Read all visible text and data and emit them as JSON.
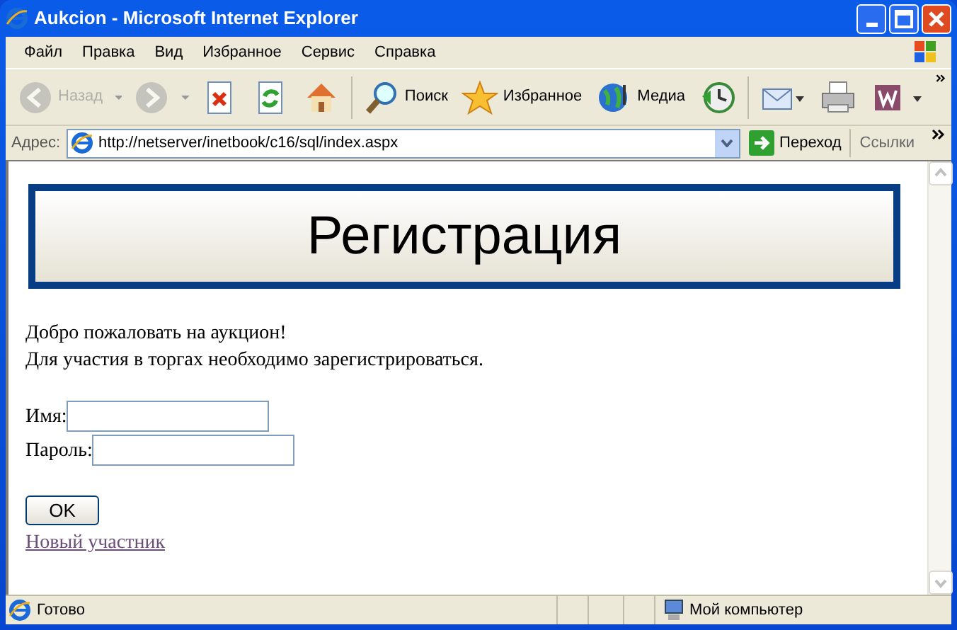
{
  "window": {
    "title": "Aukcion - Microsoft Internet Explorer"
  },
  "menu": [
    "Файл",
    "Правка",
    "Вид",
    "Избранное",
    "Сервис",
    "Справка"
  ],
  "toolbar": [
    {
      "kind": "back",
      "label": "Назад",
      "disabled": true
    },
    {
      "kind": "forward",
      "disabled": true
    },
    {
      "kind": "stop",
      "disabled": false
    },
    {
      "kind": "refresh",
      "disabled": false
    },
    {
      "kind": "home",
      "disabled": false
    },
    {
      "kind": "search",
      "label": "Поиск",
      "disabled": false
    },
    {
      "kind": "favorites",
      "label": "Избранное",
      "disabled": false
    },
    {
      "kind": "media",
      "label": "Медиа",
      "disabled": false
    },
    {
      "kind": "history",
      "disabled": false
    },
    {
      "kind": "mail",
      "disabled": false
    },
    {
      "kind": "print",
      "disabled": false
    },
    {
      "kind": "word",
      "disabled": false
    }
  ],
  "address_bar": {
    "label": "Адрес:",
    "value": "http://netserver/inetbook/c16/sql/index.aspx",
    "go": "Переход",
    "links": "Ссылки"
  },
  "page": {
    "banner": "Регистрация",
    "intro": [
      "Добро пожаловать на аукцион!",
      "Для участия в торгах необходимо зарегистрироваться."
    ],
    "fields": [
      {
        "label": "Имя:"
      },
      {
        "label": "Пароль:"
      }
    ],
    "button": "OK",
    "link": "Новый участник"
  },
  "status_bar": {
    "text": "Готово",
    "zone": "Мой компьютер"
  }
}
